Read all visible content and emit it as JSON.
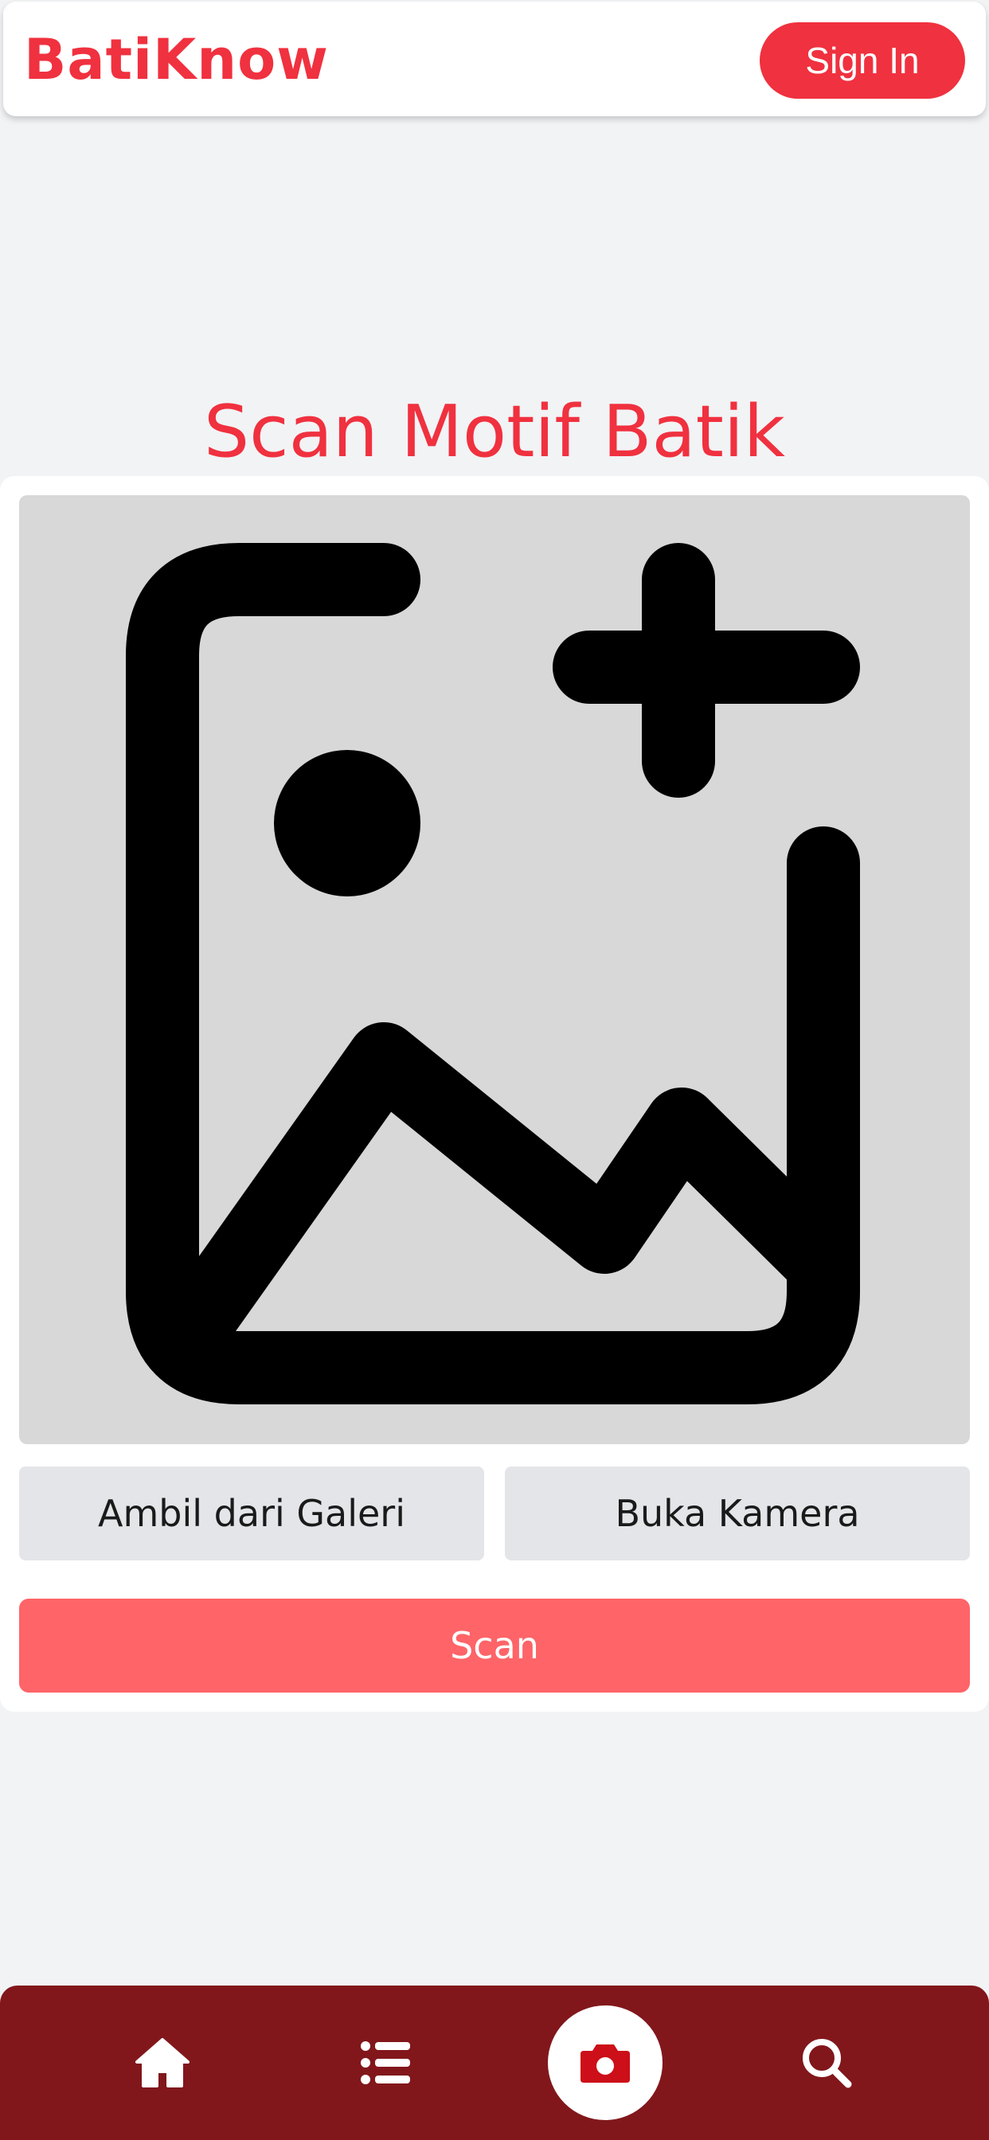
{
  "header": {
    "brand": "BatiKnow",
    "signin_label": "Sign In"
  },
  "main": {
    "title": "Scan Motif Batik",
    "preview_icon": "add-image-icon",
    "gallery_label": "Ambil dari Galeri",
    "camera_label": "Buka Kamera",
    "scan_label": "Scan"
  },
  "bottom_nav": {
    "items": [
      {
        "name": "home",
        "icon": "home-icon"
      },
      {
        "name": "list",
        "icon": "list-icon"
      },
      {
        "name": "camera",
        "icon": "camera-icon",
        "active": true
      },
      {
        "name": "search",
        "icon": "search-icon"
      }
    ]
  },
  "colors": {
    "brand": "#f0313f",
    "scan_button": "#fe6468",
    "nav_bg": "#81171b",
    "active_icon": "#cc0f18"
  }
}
